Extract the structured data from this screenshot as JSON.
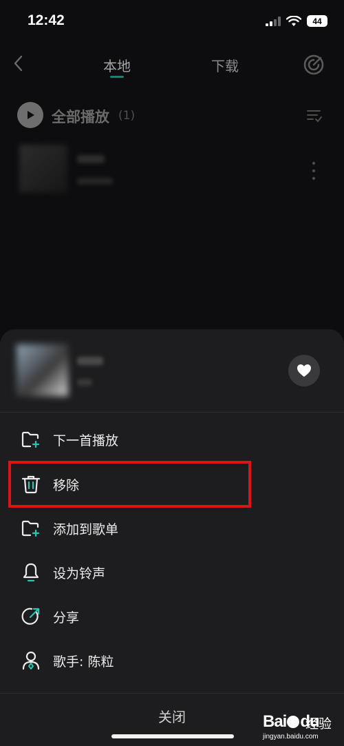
{
  "status_bar": {
    "time": "12:42",
    "battery": "44"
  },
  "header": {
    "tabs": [
      {
        "label": "本地",
        "active": true
      },
      {
        "label": "下载",
        "active": false
      }
    ]
  },
  "list": {
    "play_all_label": "全部播放",
    "play_all_count": "(1)"
  },
  "sheet": {
    "menu": [
      {
        "label": "下一首播放",
        "icon": "add-next-icon"
      },
      {
        "label": "移除",
        "icon": "trash-icon",
        "highlighted": true
      },
      {
        "label": "添加到歌单",
        "icon": "add-to-playlist-icon"
      },
      {
        "label": "设为铃声",
        "icon": "bell-icon"
      },
      {
        "label": "分享",
        "icon": "share-icon"
      },
      {
        "label": "歌手: 陈粒",
        "icon": "singer-icon"
      }
    ],
    "close_label": "关闭"
  },
  "watermark": {
    "brand": "Bai",
    "brand_du": "du",
    "cn": "经验",
    "url": "jingyan.baidu.com"
  },
  "colors": {
    "accent": "#1e7e74",
    "highlight": "#d8161a",
    "sheet_bg": "#1d1d1f"
  }
}
